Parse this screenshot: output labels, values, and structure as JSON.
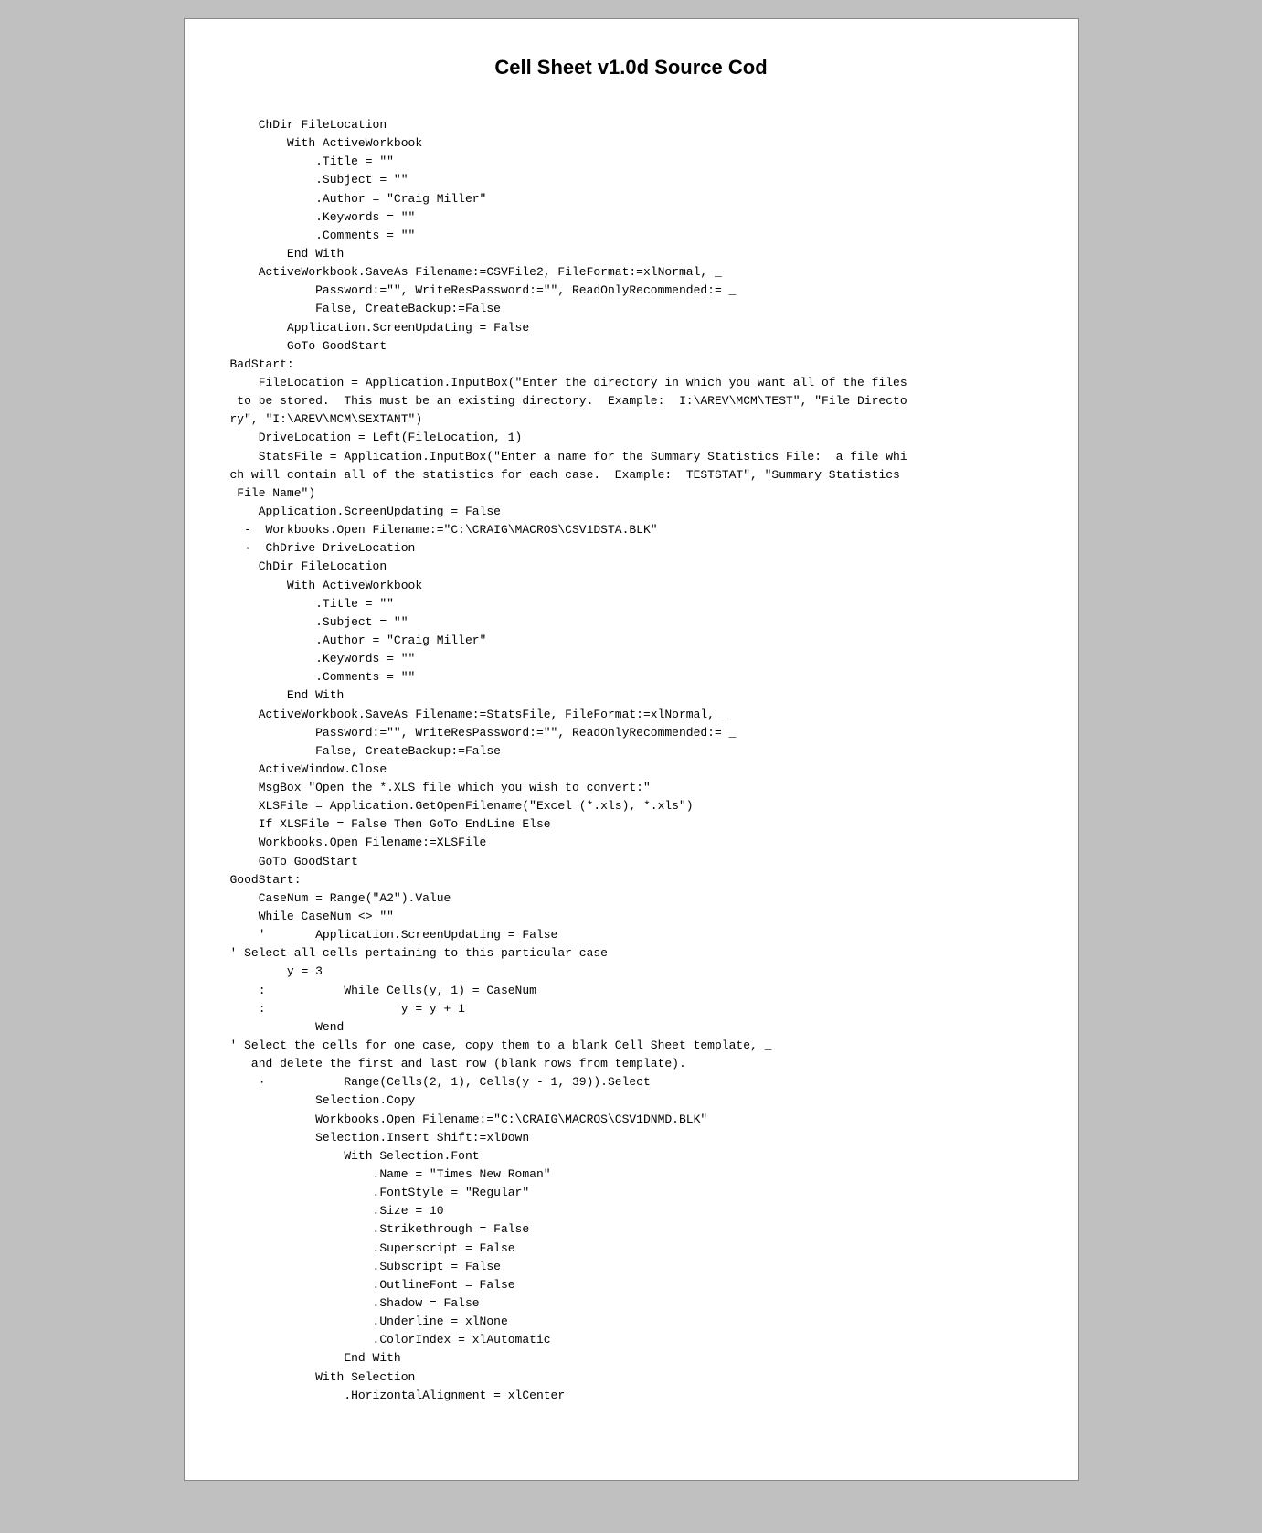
{
  "page": {
    "title": "Cell Sheet v1.0d Source Cod",
    "code": "    ChDir FileLocation\n        With ActiveWorkbook\n            .Title = \"\"\n            .Subject = \"\"\n            .Author = \"Craig Miller\"\n            .Keywords = \"\"\n            .Comments = \"\"\n        End With\n    ActiveWorkbook.SaveAs Filename:=CSVFile2, FileFormat:=xlNormal, _\n            Password:=\"\", WriteResPassword:=\"\", ReadOnlyRecommended:= _\n            False, CreateBackup:=False\n        Application.ScreenUpdating = False\n        GoTo GoodStart\nBadStart:\n    FileLocation = Application.InputBox(\"Enter the directory in which you want all of the files\n to be stored.  This must be an existing directory.  Example:  I:\\AREV\\MCM\\TEST\", \"File Directo\nry\", \"I:\\AREV\\MCM\\SEXTANT\")\n    DriveLocation = Left(FileLocation, 1)\n    StatsFile = Application.InputBox(\"Enter a name for the Summary Statistics File:  a file whi\nch will contain all of the statistics for each case.  Example:  TESTSTAT\", \"Summary Statistics\n File Name\")\n    Application.ScreenUpdating = False\n  -  Workbooks.Open Filename:=\"C:\\CRAIG\\MACROS\\CSV1DSTA.BLK\"\n  ·  ChDrive DriveLocation\n    ChDir FileLocation\n        With ActiveWorkbook\n            .Title = \"\"\n            .Subject = \"\"\n            .Author = \"Craig Miller\"\n            .Keywords = \"\"\n            .Comments = \"\"\n        End With\n    ActiveWorkbook.SaveAs Filename:=StatsFile, FileFormat:=xlNormal, _\n            Password:=\"\", WriteResPassword:=\"\", ReadOnlyRecommended:= _\n            False, CreateBackup:=False\n    ActiveWindow.Close\n    MsgBox \"Open the *.XLS file which you wish to convert:\"\n    XLSFile = Application.GetOpenFilename(\"Excel (*.xls), *.xls\")\n    If XLSFile = False Then GoTo EndLine Else\n    Workbooks.Open Filename:=XLSFile\n    GoTo GoodStart\nGoodStart:\n    CaseNum = Range(\"A2\").Value\n    While CaseNum <> \"\"\n    '       Application.ScreenUpdating = False\n' Select all cells pertaining to this particular case\n        y = 3\n    :           While Cells(y, 1) = CaseNum\n    :                   y = y + 1\n            Wend\n' Select the cells for one case, copy them to a blank Cell Sheet template, _\n   and delete the first and last row (blank rows from template).\n    ·           Range(Cells(2, 1), Cells(y - 1, 39)).Select\n            Selection.Copy\n            Workbooks.Open Filename:=\"C:\\CRAIG\\MACROS\\CSV1DNMD.BLK\"\n            Selection.Insert Shift:=xlDown\n                With Selection.Font\n                    .Name = \"Times New Roman\"\n                    .FontStyle = \"Regular\"\n                    .Size = 10\n                    .Strikethrough = False\n                    .Superscript = False\n                    .Subscript = False\n                    .OutlineFont = False\n                    .Shadow = False\n                    .Underline = xlNone\n                    .ColorIndex = xlAutomatic\n                End With\n            With Selection\n                .HorizontalAlignment = xlCenter"
  }
}
